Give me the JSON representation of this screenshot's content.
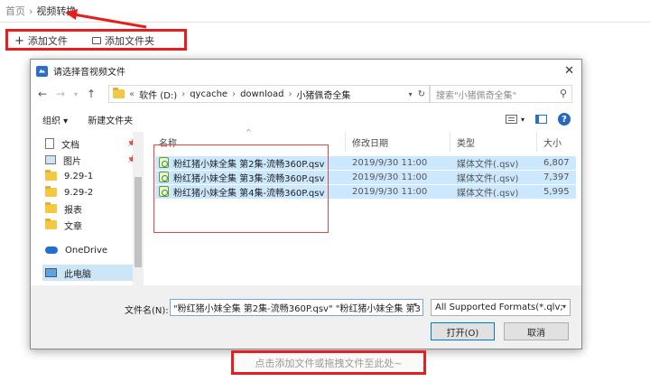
{
  "breadcrumb": {
    "home": "首页",
    "sep": "›",
    "current": "视频转换"
  },
  "toolbar": {
    "add_file": "添加文件",
    "add_folder": "添加文件夹"
  },
  "drop_hint": "点击添加文件或拖拽文件至此处~",
  "dialog": {
    "title": "请选择音视频文件",
    "close": "✕",
    "address": {
      "prefix": "«",
      "parts": [
        "软件 (D:)",
        "qycache",
        "download",
        "小猪佩奇全集"
      ],
      "sep": "›"
    },
    "search_placeholder": "搜索\"小猪佩奇全集\"",
    "commands": {
      "organize": "组织 ▾",
      "new_folder": "新建文件夹"
    },
    "nav_items": [
      {
        "label": "文档",
        "icon": "document-icon",
        "pinned": true
      },
      {
        "label": "图片",
        "icon": "picture-icon",
        "pinned": true
      },
      {
        "label": "9.29-1",
        "icon": "folder-icon",
        "pinned": false
      },
      {
        "label": "9.29-2",
        "icon": "folder-icon",
        "pinned": false
      },
      {
        "label": "报表",
        "icon": "folder-icon",
        "pinned": false
      },
      {
        "label": "文章",
        "icon": "folder-icon",
        "pinned": false
      },
      {
        "label": "OneDrive",
        "icon": "onedrive-icon",
        "pinned": false
      },
      {
        "label": "此电脑",
        "icon": "computer-icon",
        "pinned": false,
        "selected": true
      }
    ],
    "columns": {
      "name": "名称",
      "modified": "修改日期",
      "type": "类型",
      "size": "大小"
    },
    "files": [
      {
        "name": "粉红猪小妹全集 第2集-流畅360P.qsv",
        "modified": "2019/9/30 11:00",
        "type": "媒体文件(.qsv)",
        "size": "6,807"
      },
      {
        "name": "粉红猪小妹全集 第3集-流畅360P.qsv",
        "modified": "2019/9/30 11:00",
        "type": "媒体文件(.qsv)",
        "size": "7,397"
      },
      {
        "name": "粉红猪小妹全集 第4集-流畅360P.qsv",
        "modified": "2019/9/30 11:00",
        "type": "媒体文件(.qsv)",
        "size": "5,995"
      }
    ],
    "filename_label": "文件名(N):",
    "filename_value": "\"粉红猪小妹全集 第2集-流畅360P.qsv\" \"粉红猪小妹全集 第3",
    "format_value": "All Supported Formats(*.qlv;",
    "open_button": "打开(O)",
    "cancel_button": "取消"
  },
  "colors": {
    "highlight_red": "#e51f1f",
    "selection_blue": "#cce8ff",
    "accent": "#0078d7"
  }
}
